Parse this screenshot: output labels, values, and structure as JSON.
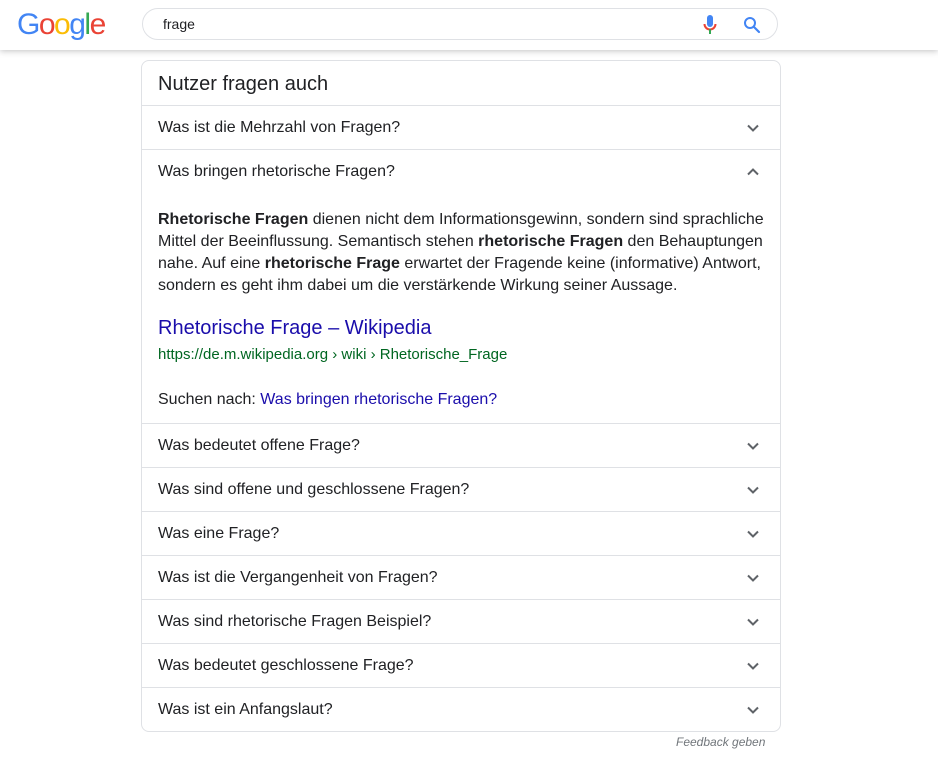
{
  "header": {
    "logo": [
      "G",
      "o",
      "o",
      "g",
      "l",
      "e"
    ],
    "logo_colors": [
      "#4285F4",
      "#EA4335",
      "#FBBC05",
      "#4285F4",
      "#34A853",
      "#EA4335"
    ],
    "search_value": "frage"
  },
  "paa": {
    "title": "Nutzer fragen auch",
    "questions": [
      "Was ist die Mehrzahl von Fragen?",
      "Was bringen rhetorische Fragen?",
      "Was bedeutet offene Frage?",
      "Was sind offene und geschlossene Fragen?",
      "Was eine Frage?",
      "Was ist die Vergangenheit von Fragen?",
      "Was sind rhetorische Fragen Beispiel?",
      "Was bedeutet geschlossene Frage?",
      "Was ist ein Anfangslaut?"
    ],
    "expanded_index": 1,
    "answer": {
      "p1_bold": "Rhetorische Fragen",
      "p1_text": " dienen nicht dem Informationsgewinn, sondern sind sprachliche Mittel der Beeinflussung. Semantisch stehen ",
      "p2_bold": "rhetorische Fragen",
      "p2_text": " den Behauptungen nahe. Auf eine ",
      "p3_bold": "rhetorische Frage",
      "p3_text": " erwartet der Fragende keine (informative) Antwort, sondern es geht ihm dabei um die verstärkende Wirkung seiner Aussage."
    },
    "source_title": "Rhetorische Frage – Wikipedia",
    "source_url": "https://de.m.wikipedia.org › wiki › Rhetorische_Frage",
    "search_for_label": "Suchen nach: ",
    "search_for_link": "Was bringen rhetorische Fragen?"
  },
  "feedback": "Feedback geben",
  "colors": {
    "link": "#1a0dab",
    "url": "#006621",
    "mic_blue": "#4285F4",
    "mic_red": "#EA4335"
  }
}
